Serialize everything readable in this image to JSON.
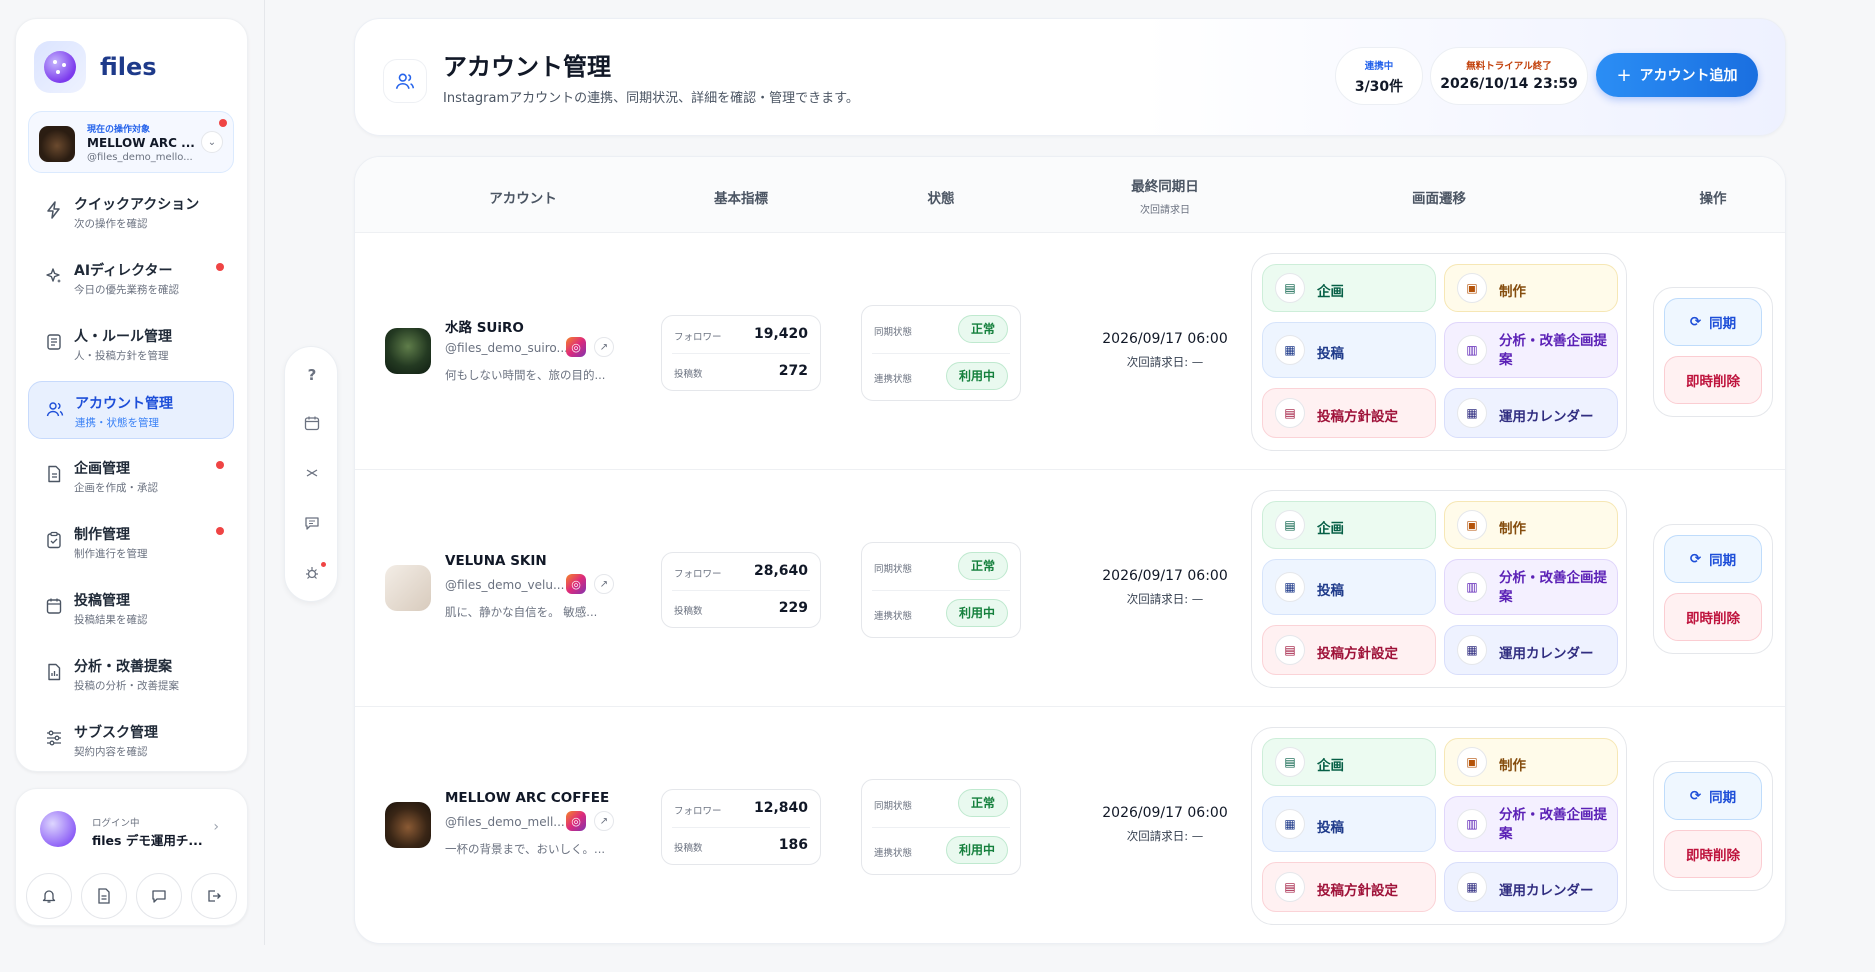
{
  "brand": {
    "name": "files"
  },
  "target": {
    "caption": "現在の操作対象",
    "name": "MELLOW ARC ...",
    "handle": "@files_demo_mello..."
  },
  "nav": [
    {
      "title": "クイックアクション",
      "sub": "次の操作を確認",
      "icon": "bolt-icon"
    },
    {
      "title": "AIディレクター",
      "sub": "今日の優先業務を確認",
      "icon": "sparkle-icon"
    },
    {
      "title": "人・ルール管理",
      "sub": "人・投稿方針を管理",
      "icon": "document-list-icon"
    },
    {
      "title": "アカウント管理",
      "sub": "連携・状態を管理",
      "icon": "users-icon"
    },
    {
      "title": "企画管理",
      "sub": "企画を作成・承認",
      "icon": "document-icon"
    },
    {
      "title": "制作管理",
      "sub": "制作進行を管理",
      "icon": "clipboard-icon"
    },
    {
      "title": "投稿管理",
      "sub": "投稿結果を確認",
      "icon": "calendar-icon"
    },
    {
      "title": "分析・改善提案",
      "sub": "投稿の分析・改善提案",
      "icon": "report-icon"
    },
    {
      "title": "サブスク管理",
      "sub": "契約内容を確認",
      "icon": "sliders-icon"
    }
  ],
  "user": {
    "status": "ログイン中",
    "name": "files デモ運用チ..."
  },
  "header": {
    "title": "アカウント管理",
    "subtitle": "Instagramアカウントの連携、同期状況、詳細を確認・管理できます。",
    "linked_label": "連携中",
    "linked_value": "3/30件",
    "trial_label": "無料トライアル終了",
    "trial_value": "2026/10/14 23:59",
    "add_button": "アカウント追加"
  },
  "columns": {
    "account": "アカウント",
    "metrics": "基本指標",
    "status": "状態",
    "last_sync": "最終同期日",
    "next_request": "次回請求日",
    "navigation": "画面遷移",
    "actions": "操作"
  },
  "labels": {
    "followers": "フォロワー",
    "posts": "投稿数",
    "sync_state": "同期状態",
    "link_state": "連携状態",
    "nav_plan": "企画",
    "nav_production": "制作",
    "nav_post": "投稿",
    "nav_analysis": "分析・改善企画提案",
    "nav_policy": "投稿方針設定",
    "nav_calendar": "運用カレンダー",
    "sync_button": "同期",
    "delete_button": "即時削除"
  },
  "accounts": [
    {
      "name": "水路 SUiRO",
      "handle": "@files_demo_suiro...",
      "desc": "何もしない時間を、旅の目的...",
      "followers": "19,420",
      "posts": "272",
      "sync_status": "正常",
      "link_status": "利用中",
      "last_sync": "2026/09/17 06:00",
      "next_billing": "次回請求日: —"
    },
    {
      "name": "VELUNA SKIN",
      "handle": "@files_demo_velu...",
      "desc": "肌に、静かな自信を。 敏感...",
      "followers": "28,640",
      "posts": "229",
      "sync_status": "正常",
      "link_status": "利用中",
      "last_sync": "2026/09/17 06:00",
      "next_billing": "次回請求日: —"
    },
    {
      "name": "MELLOW ARC COFFEE",
      "handle": "@files_demo_mell...",
      "desc": "一杯の背景まで、おいしく。...",
      "followers": "12,840",
      "posts": "186",
      "sync_status": "正常",
      "link_status": "利用中",
      "last_sync": "2026/09/17 06:00",
      "next_billing": "次回請求日: —"
    }
  ],
  "colors": {
    "accent": "#1a6fe0",
    "success": "#15803d",
    "danger": "#be123c",
    "alert_dot": "#ef4444"
  }
}
